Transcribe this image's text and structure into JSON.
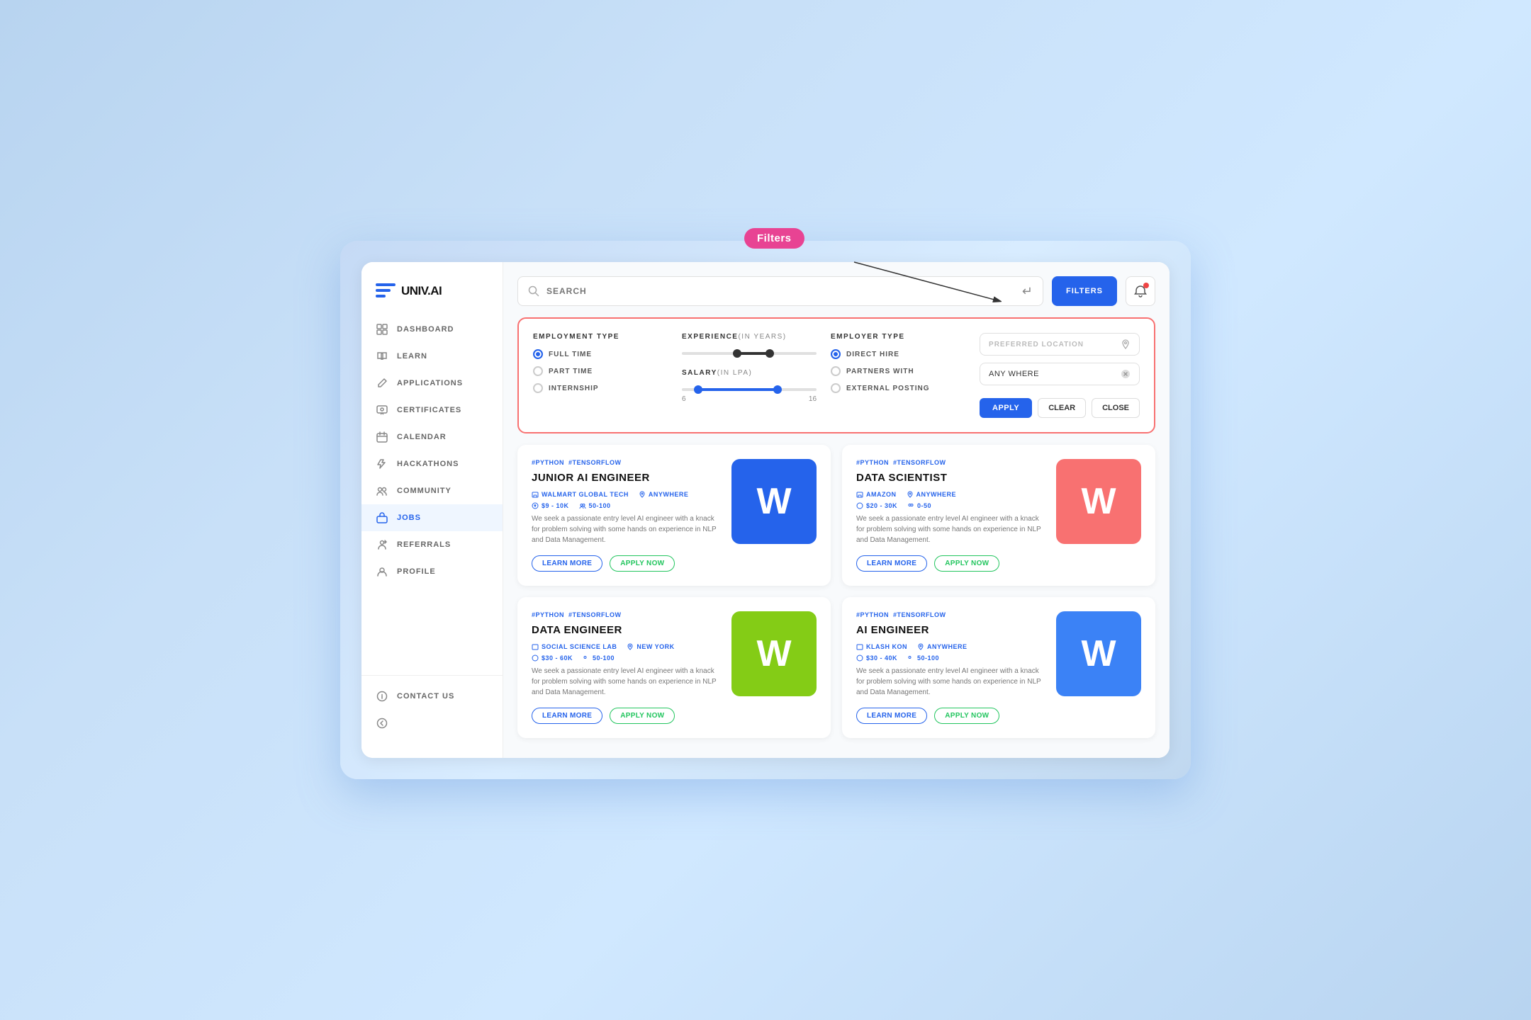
{
  "app": {
    "name": "UNIV.AI"
  },
  "filters_tooltip": "Filters",
  "topbar": {
    "search_placeholder": "SEARCH",
    "filters_button": "FILTERS"
  },
  "filter_panel": {
    "employment_type_label": "EMPLOYMENT TYPE",
    "experience_label": "EXPERIENCE",
    "experience_unit": "(IN YEARS)",
    "employer_type_label": "EMPLOYER TYPE",
    "preferred_location_label": "PREFERRED LOCATION",
    "location_value": "ANY WHERE",
    "apply_btn": "APPLY",
    "clear_btn": "CLEAR",
    "close_btn": "CLOSE",
    "salary_label": "SALARY",
    "salary_unit": "(IN LPA)",
    "salary_min": "6",
    "salary_max": "16",
    "employment_options": [
      {
        "label": "FULL TIME",
        "selected": true
      },
      {
        "label": "PART TIME",
        "selected": false
      },
      {
        "label": "INTERNSHIP",
        "selected": false
      }
    ],
    "employer_options": [
      {
        "label": "DIRECT HIRE",
        "selected": true
      },
      {
        "label": "PARTNERS WITH",
        "selected": false
      },
      {
        "label": "EXTERNAL POSTING",
        "selected": false
      }
    ]
  },
  "sidebar": {
    "items": [
      {
        "label": "DASHBOARD",
        "icon": "grid-icon",
        "active": false
      },
      {
        "label": "LEARN",
        "icon": "book-icon",
        "active": false
      },
      {
        "label": "APPLICATIONS",
        "icon": "edit-icon",
        "active": false
      },
      {
        "label": "CERTIFICATES",
        "icon": "certificate-icon",
        "active": false
      },
      {
        "label": "CALENDAR",
        "icon": "calendar-icon",
        "active": false
      },
      {
        "label": "HACKATHONS",
        "icon": "hackathon-icon",
        "active": false
      },
      {
        "label": "COMMUNITY",
        "icon": "community-icon",
        "active": false
      },
      {
        "label": "JOBS",
        "icon": "jobs-icon",
        "active": true
      },
      {
        "label": "REFERRALS",
        "icon": "referrals-icon",
        "active": false
      },
      {
        "label": "PROFILE",
        "icon": "profile-icon",
        "active": false
      }
    ],
    "bottom_items": [
      {
        "label": "CONTACT US",
        "icon": "contact-icon"
      }
    ]
  },
  "jobs": [
    {
      "tags": [
        "#PYTHON",
        "#TENSORFLOW"
      ],
      "title": "JUNIOR AI ENGINEER",
      "company": "WALMART GLOBAL TECH",
      "location": "ANYWHERE",
      "salary": "$9 - 10K",
      "team_size": "50-100",
      "description": "We seek a passionate entry level AI engineer with a knack for problem solving with some hands on experience in NLP and Data Management.",
      "logo_letter": "W",
      "logo_color": "blue"
    },
    {
      "tags": [
        "#PYTHON",
        "#TENSORFLOW"
      ],
      "title": "DATA SCIENTIST",
      "company": "AMAZON",
      "location": "ANYWHERE",
      "salary": "$20 - 30K",
      "team_size": "0-50",
      "description": "We seek a passionate entry level AI engineer with a knack for problem solving with some hands on experience in NLP and Data Management.",
      "logo_letter": "W",
      "logo_color": "red"
    },
    {
      "tags": [
        "#PYTHON",
        "#TENSORFLOW"
      ],
      "title": "DATA ENGINEER",
      "company": "SOCIAL SCIENCE LAB",
      "location": "NEW YORK",
      "salary": "$30 - 60K",
      "team_size": "50-100",
      "description": "We seek a passionate entry level AI engineer with a knack for problem solving with some hands on experience in NLP and Data Management.",
      "logo_letter": "W",
      "logo_color": "green"
    },
    {
      "tags": [
        "#PYTHON",
        "#TENSORFLOW"
      ],
      "title": "AI ENGINEER",
      "company": "KLASH KON",
      "location": "ANYWHERE",
      "salary": "$30 - 40K",
      "team_size": "50-100",
      "description": "We seek a passionate entry level AI engineer with a knack for problem solving with some hands on experience in NLP and Data Management.",
      "logo_letter": "W",
      "logo_color": "blue2"
    }
  ],
  "buttons": {
    "learn_more": "LEARN MORE",
    "apply_now": "APPLY NOW"
  }
}
